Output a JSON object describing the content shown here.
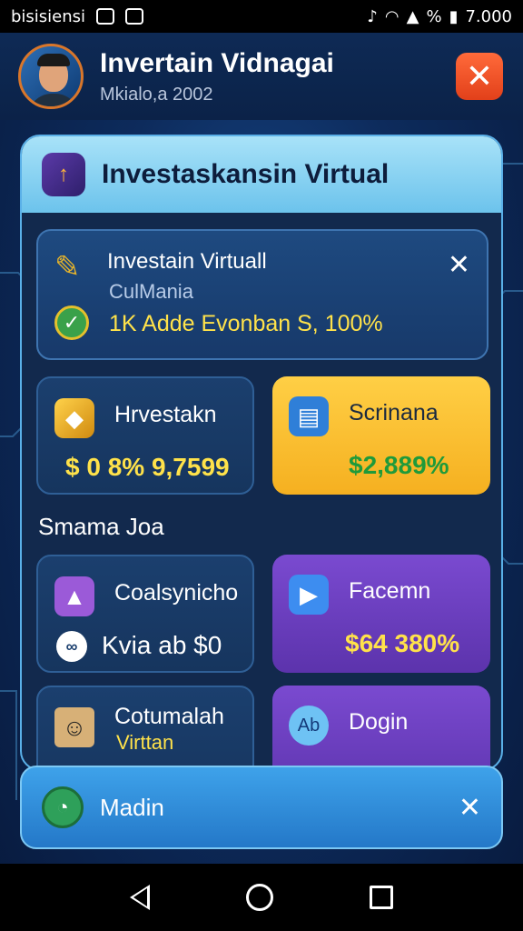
{
  "status_bar": {
    "carrier": "bisisiensi",
    "time": "7.000",
    "battery_label": "%"
  },
  "header": {
    "title": "Invertain Vidnagai",
    "subtitle": "Mkialo,a 2002",
    "close_label": "✕"
  },
  "panel": {
    "title": "Investaskansin Virtual",
    "notification": {
      "title": "Investain Virtuall",
      "subtitle": "CulMania",
      "line": "1K Adde Evonban S, 100%",
      "close_label": "✕"
    },
    "tiles_top": [
      {
        "label": "Hrvestakn",
        "value": "$ 0 8% 9,7599",
        "icon": "laptop-gold-icon"
      },
      {
        "label": "Scrinana",
        "value": "$2,889%",
        "icon": "document-icon"
      }
    ],
    "section_title": "Smama Joa",
    "tiles_bottom": [
      {
        "label": "Coalsynicho",
        "value": "Kvia ab $0",
        "icon": "chart-icon",
        "sub_icon": "link-icon"
      },
      {
        "label": "Facemn",
        "value": "$64 380%",
        "icon": "play-icon"
      },
      {
        "label": "Cotumalah",
        "sublabel": "Virttan",
        "icon": "profile-icon"
      },
      {
        "label": "Dogin",
        "icon": "ab-icon",
        "icon_text": "Ab"
      }
    ]
  },
  "bottom_bar": {
    "label": "Madin",
    "close_label": "✕"
  },
  "colors": {
    "accent_yellow": "#ffe24a",
    "value_green": "#3cd070",
    "tile_purple": "#6a3dc0",
    "tile_yellow": "#f8c030",
    "close_red": "#f05028"
  }
}
